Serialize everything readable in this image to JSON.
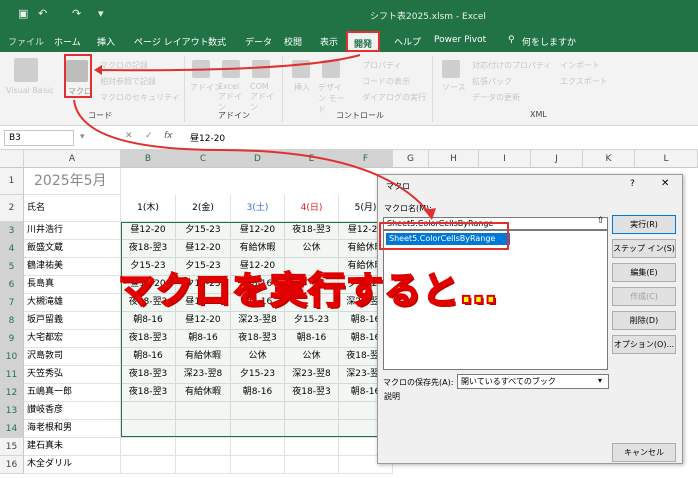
{
  "window": {
    "title": "シフト表2025.xlsm  -  Excel"
  },
  "tabs": [
    "ファイル",
    "ホーム",
    "挿入",
    "ページ レイアウト",
    "数式",
    "データ",
    "校閲",
    "表示",
    "開発",
    "ヘルプ",
    "Power Pivot",
    "何をしますか"
  ],
  "active_tab": "開発",
  "ribbon": {
    "groups": [
      "コード",
      "アドイン",
      "コントロール",
      "XML"
    ],
    "code": {
      "visual_basic": "Visual Basic",
      "macro": "マクロ",
      "record": "マクロの記録",
      "relative": "相対参照で記録",
      "security": "マクロのセキュリティ"
    },
    "addin": {
      "addin": "アドイン",
      "excel_addin": "Excel アドイン",
      "com_addin": "COM アドイン"
    },
    "control": {
      "insert": "挿入",
      "design": "デザイン モード",
      "props": "プロパティ",
      "code_view": "コードの表示",
      "dialog": "ダイアログの実行"
    },
    "xml": {
      "source": "ソース",
      "map_props": "対応付けのプロパティ",
      "expansion": "拡張パック",
      "refresh": "データの更新",
      "import": "インポート",
      "export": "エクスポート"
    }
  },
  "formula_bar": {
    "name_box": "B3",
    "fx": "fx",
    "formula": "昼12-20"
  },
  "columns": [
    "A",
    "B",
    "C",
    "D",
    "E",
    "F",
    "G",
    "H",
    "I",
    "J",
    "K",
    "L"
  ],
  "rows": [
    "1",
    "2",
    "3",
    "4",
    "5",
    "6",
    "7",
    "8",
    "9",
    "10",
    "11",
    "12",
    "13",
    "14",
    "15",
    "16"
  ],
  "sheet": {
    "title": "2025年5月",
    "header_label": "氏名",
    "day_headers": [
      "1(木)",
      "2(金)",
      "3(土)",
      "4(日)",
      "5(月)"
    ],
    "names": [
      "川井浩行",
      "飯盛文蔵",
      "鶴津祐美",
      "長島真",
      "大槻滝雄",
      "坂戸留義",
      "大宅都宏",
      "沢島敦司",
      "天笠秀弘",
      "五嶋真一郎",
      "讃岐香彦",
      "海老根和男",
      "建石真未",
      "木全ダリル"
    ],
    "shifts": [
      [
        "昼12-20",
        "夕15-23",
        "昼12-20",
        "夜18-翌3",
        "昼12-20"
      ],
      [
        "夜18-翌3",
        "昼12-20",
        "有給休暇",
        "公休",
        "有給休暇"
      ],
      [
        "夕15-23",
        "夕15-23",
        "昼12-20",
        "",
        "有給休暇"
      ],
      [
        "昼12-20",
        "夕15-23",
        "朝8-16",
        "",
        "夕15-23"
      ],
      [
        "夜18-翌3",
        "昼12-20",
        "朝8-16",
        "",
        "深23-翌8"
      ],
      [
        "朝8-16",
        "昼12-20",
        "深23-翌8",
        "夕15-23",
        "朝8-16"
      ],
      [
        "夜18-翌3",
        "朝8-16",
        "夜18-翌3",
        "朝8-16",
        "朝8-16"
      ],
      [
        "朝8-16",
        "有給休暇",
        "公休",
        "公休",
        "夜18-翌3"
      ],
      [
        "夜18-翌3",
        "深23-翌8",
        "夕15-23",
        "深23-翌8",
        "深23-翌8"
      ],
      [
        "夜18-翌3",
        "有給休暇",
        "朝8-16",
        "夜18-翌3",
        "朝8-16"
      ],
      [
        "",
        "",
        "",
        "",
        ""
      ],
      [
        "",
        "",
        "",
        "",
        ""
      ]
    ]
  },
  "dialog": {
    "title": "マクロ",
    "help": "?",
    "close": "✕",
    "macro_name_label": "マクロ名(M):",
    "macro_name_value": "Sheet5.ColorCellsByRange",
    "macro_list": [
      "Sheet5.ColorCellsByRange"
    ],
    "store_label": "マクロの保存先(A):",
    "store_value": "開いているすべてのブック",
    "description_label": "説明",
    "buttons": [
      "実行(R)",
      "ステップ イン(S)",
      "編集(E)",
      "作成(C)",
      "削除(D)",
      "オプション(O)..."
    ],
    "cancel": "キャンセル"
  },
  "overlay": {
    "text": "マクロを実行すると…"
  },
  "colors": {
    "excel_green": "#217346",
    "annotation_red": "#e03030",
    "overlay_yellow": "#ffff00",
    "saturday": "#2f6fd6",
    "sunday": "#e02020"
  }
}
